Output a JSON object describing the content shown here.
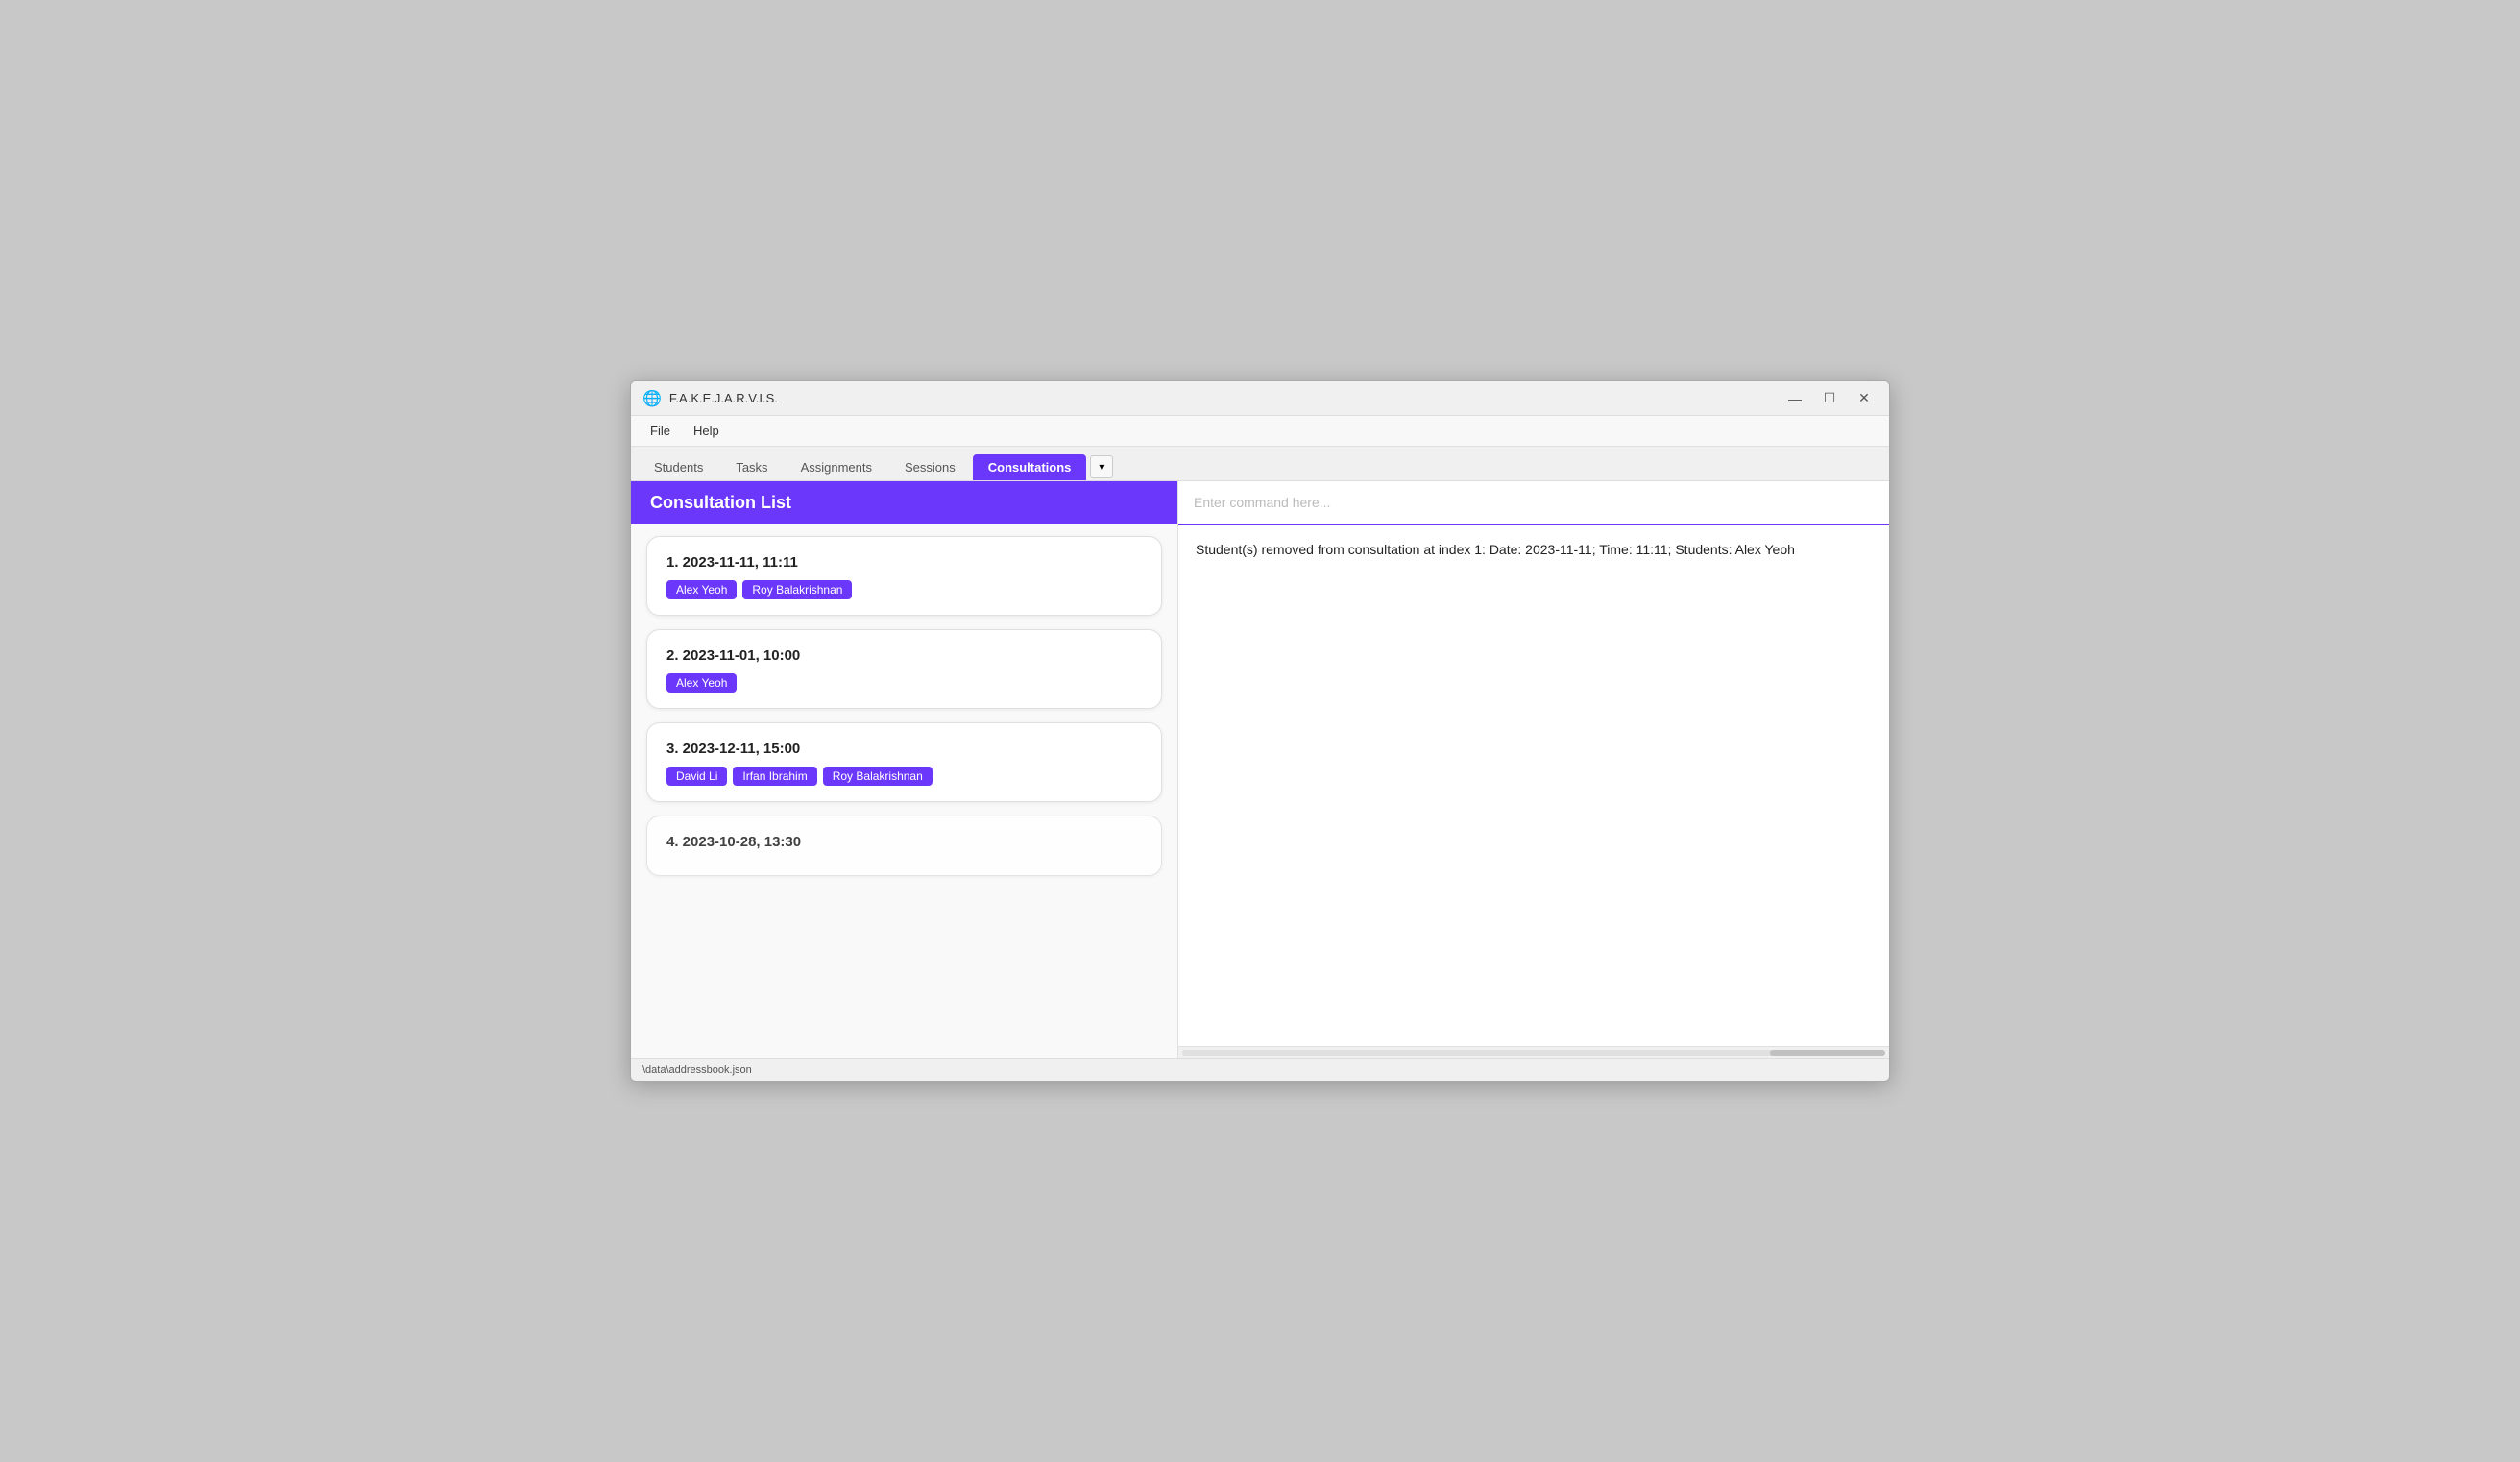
{
  "window": {
    "title": "F.A.K.E.J.A.R.V.I.S.",
    "icon": "🌐"
  },
  "title_bar_controls": {
    "minimize": "—",
    "maximize": "☐",
    "close": "✕"
  },
  "menu": {
    "items": [
      "File",
      "Help"
    ]
  },
  "tabs": [
    {
      "label": "Students",
      "active": false
    },
    {
      "label": "Tasks",
      "active": false
    },
    {
      "label": "Assignments",
      "active": false
    },
    {
      "label": "Sessions",
      "active": false
    },
    {
      "label": "Consultations",
      "active": true
    }
  ],
  "tab_overflow_label": "▾",
  "left_panel": {
    "header": "Consultation List",
    "consultations": [
      {
        "index": 1,
        "date": "2023-11-11",
        "time": "11:11",
        "label": "1.  2023-11-11,  11:11",
        "students": [
          "Alex Yeoh",
          "Roy Balakrishnan"
        ]
      },
      {
        "index": 2,
        "date": "2023-11-01",
        "time": "10:00",
        "label": "2.  2023-11-01,  10:00",
        "students": [
          "Alex Yeoh"
        ]
      },
      {
        "index": 3,
        "date": "2023-12-11",
        "time": "15:00",
        "label": "3.  2023-12-11,  15:00",
        "students": [
          "David Li",
          "Irfan Ibrahim",
          "Roy Balakrishnan"
        ]
      },
      {
        "index": 4,
        "date": "2023-10-28",
        "time": "13:30",
        "label": "4.  2023-10-28,  13:30",
        "students": [],
        "partial": true
      }
    ]
  },
  "right_panel": {
    "command_placeholder": "Enter command here...",
    "output_text": "Student(s) removed from consultation at index 1: Date: 2023-11-11; Time: 11:11; Students: Alex Yeoh"
  },
  "status_bar": {
    "text": "\\data\\addressbook.json"
  },
  "colors": {
    "accent": "#6B38FB"
  }
}
